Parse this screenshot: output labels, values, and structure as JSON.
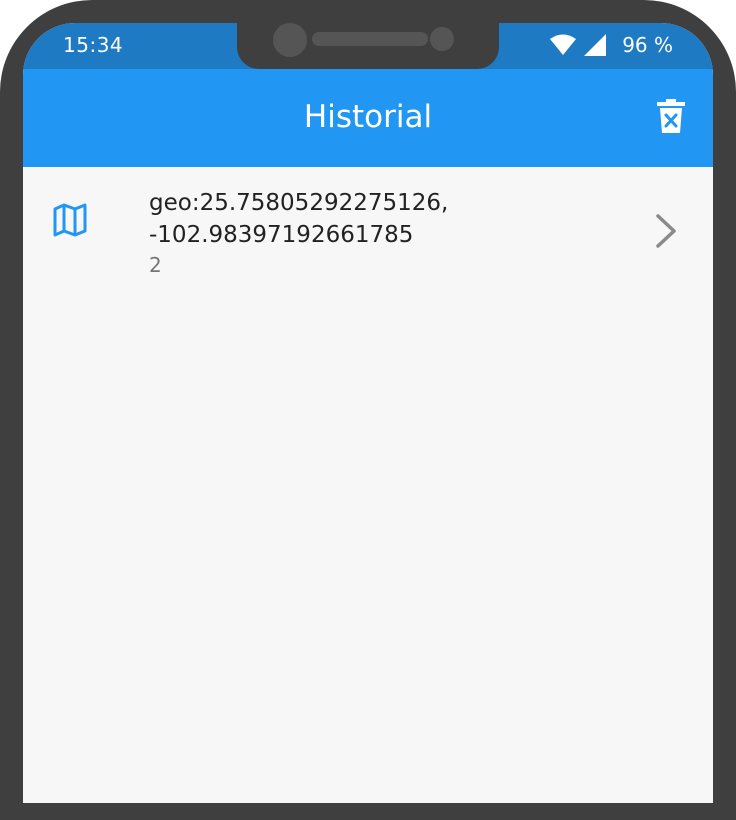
{
  "status_bar": {
    "time": "15:34",
    "battery": "96 %",
    "icons": [
      "wifi-icon",
      "cell-signal-icon"
    ]
  },
  "app_bar": {
    "title": "Historial",
    "action_icon": "delete-sweep-icon"
  },
  "history": {
    "items": [
      {
        "icon": "map-icon",
        "title": "geo:25.75805292275126,\n-102.98397192661785",
        "subtitle": "2",
        "trailing_icon": "chevron-right-icon"
      }
    ]
  },
  "colors": {
    "status_bar": "#1e7ac3",
    "app_bar": "#2196f3",
    "accent_icon": "#2196f3",
    "background": "#f7f7f7",
    "frame": "#3f3f3f"
  }
}
